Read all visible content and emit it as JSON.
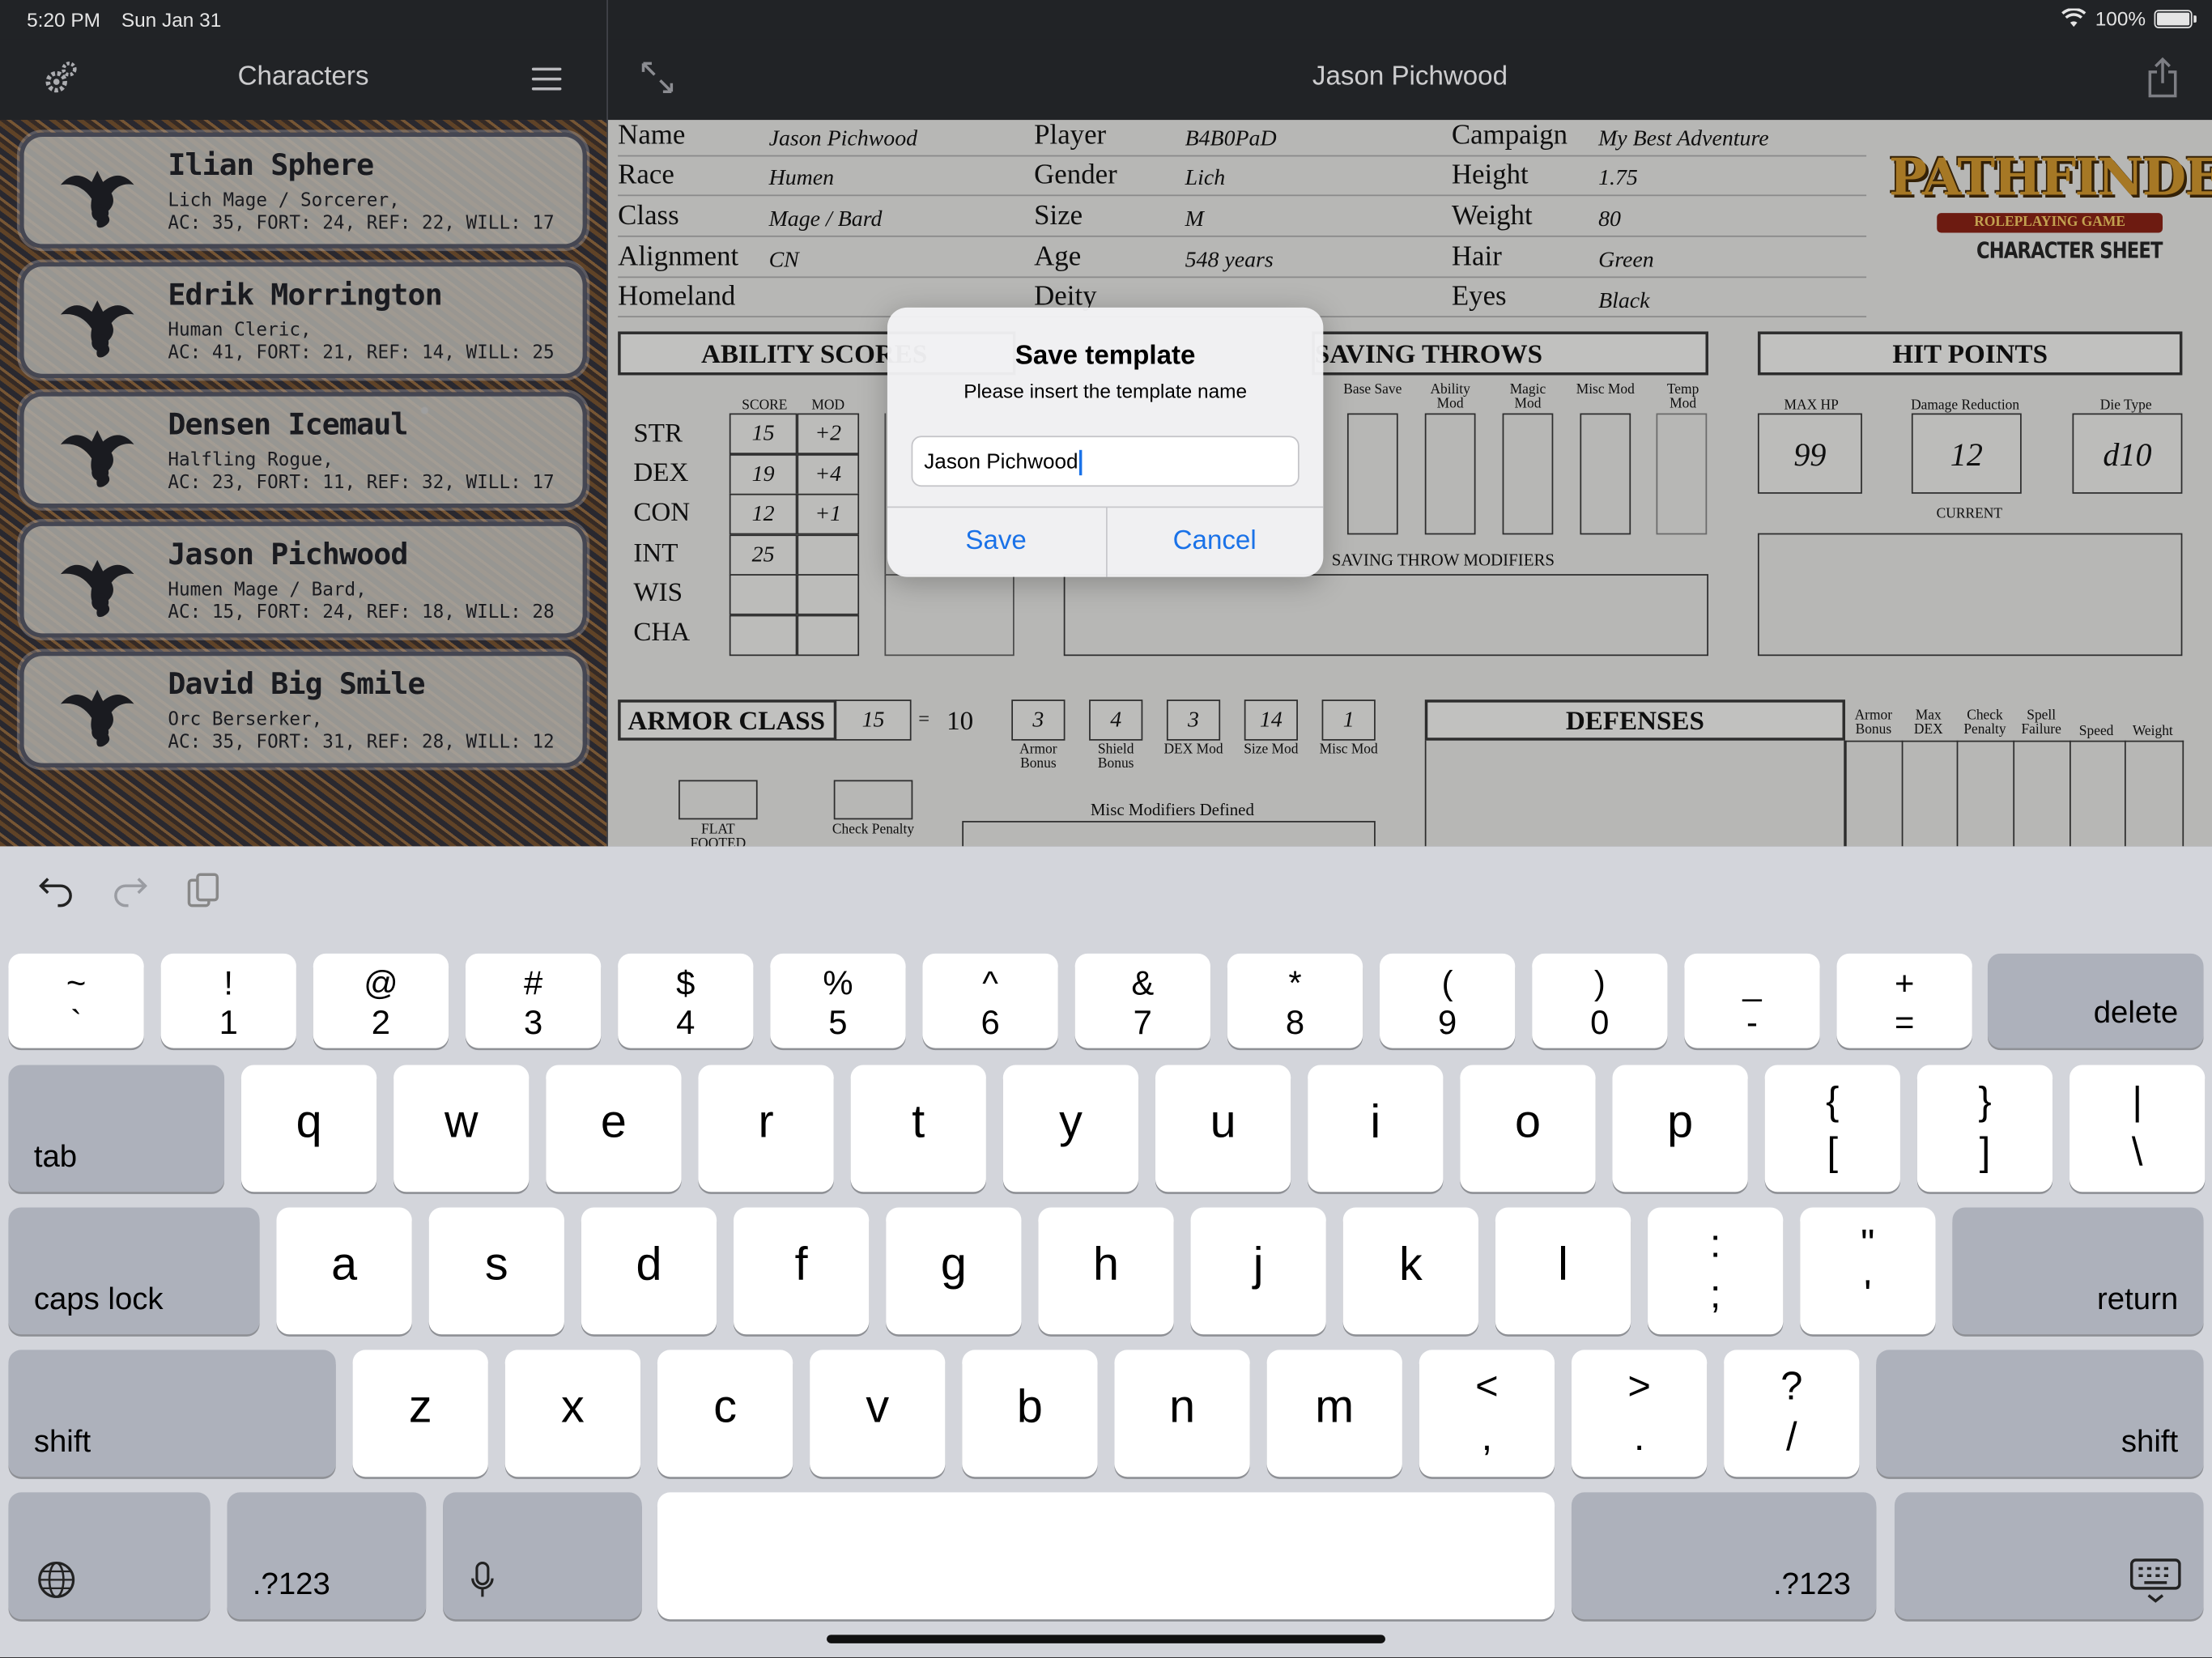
{
  "status": {
    "time": "5:20 PM",
    "date": "Sun Jan 31",
    "battery": "100%"
  },
  "sidebar": {
    "title": "Characters",
    "characters": [
      {
        "name": "Ilian Sphere",
        "line1": "Lich  Mage / Sorcerer,",
        "line2": "AC: 35, FORT: 24, REF: 22, WILL: 17"
      },
      {
        "name": "Edrik Morrington",
        "line1": "Human  Cleric,",
        "line2": "AC: 41, FORT: 21, REF: 14, WILL: 25"
      },
      {
        "name": "Densen Icemaul",
        "line1": "Halfling  Rogue,",
        "line2": "AC: 23, FORT: 11, REF: 32, WILL: 17"
      },
      {
        "name": "Jason Pichwood",
        "line1": "Humen  Mage / Bard,",
        "line2": "AC: 15, FORT: 24, REF: 18, WILL: 28"
      },
      {
        "name": "David Big Smile",
        "line1": "Orc  Berserker,",
        "line2": "AC: 35, FORT: 31, REF: 28, WILL: 12"
      }
    ]
  },
  "detail": {
    "title": "Jason Pichwood"
  },
  "sheet": {
    "labels": {
      "name": "Name",
      "player": "Player",
      "campaign": "Campaign",
      "race": "Race",
      "gender": "Gender",
      "height": "Height",
      "class": "Class",
      "size": "Size",
      "weight": "Weight",
      "alignment": "Alignment",
      "age": "Age",
      "hair": "Hair",
      "homeland": "Homeland",
      "deity": "Deity",
      "eyes": "Eyes"
    },
    "values": {
      "name": "Jason Pichwood",
      "player": "B4B0PaD",
      "campaign": "My Best Adventure",
      "race": "Humen",
      "gender": "Lich",
      "height": "1.75",
      "class": "Mage / Bard",
      "size": "M",
      "weight": "80",
      "alignment": "CN",
      "age": "548 years",
      "hair": "Green",
      "eyes": "Black"
    },
    "logo": {
      "title": "PATHFINDER",
      "sub": "ROLEPLAYING GAME",
      "caption": "CHARACTER SHEET"
    },
    "ability": {
      "header": "ABILITY SCORES",
      "score_hdr": "SCORE",
      "mod_hdr": "MOD",
      "rows": [
        {
          "label": "STR",
          "score": "15",
          "mod": "+2"
        },
        {
          "label": "DEX",
          "score": "19",
          "mod": "+4"
        },
        {
          "label": "CON",
          "score": "12",
          "mod": "+1"
        },
        {
          "label": "INT",
          "score": "25",
          "mod": ""
        },
        {
          "label": "WIS",
          "score": "",
          "mod": ""
        },
        {
          "label": "CHA",
          "score": "",
          "mod": ""
        }
      ]
    },
    "saves": {
      "header": "SAVING THROWS",
      "cols": [
        "Base Save",
        "Ability Mod",
        "Magic Mod",
        "Misc Mod",
        "Temp Mod"
      ],
      "modifiers": "SAVING THROW MODIFIERS"
    },
    "hp": {
      "header": "HIT POINTS",
      "max_lbl": "MAX HP",
      "dr_lbl": "Damage Reduction",
      "die_lbl": "Die Type",
      "max": "99",
      "dr": "12",
      "die": "d10",
      "current": "CURRENT"
    },
    "ac": {
      "header": "ARMOR CLASS",
      "total": "15",
      "base": "10",
      "armor": "3",
      "shield": "4",
      "dex": "3",
      "size": "14",
      "misc": "1",
      "armor_lbl": "Armor Bonus",
      "shield_lbl": "Shield Bonus",
      "dex_lbl": "DEX Mod",
      "size_lbl": "Size Mod",
      "misc_lbl": "Misc Mod",
      "flat": "FLAT FOOTED",
      "check": "Check Penalty",
      "misc_defined": "Misc  Modifiers  Defined"
    },
    "defenses": {
      "header": "DEFENSES",
      "cols": [
        "Armor Bonus",
        "Max DEX",
        "Check Penalty",
        "Spell Failure",
        "Speed",
        "Weight"
      ]
    }
  },
  "dialog": {
    "title": "Save template",
    "message": "Please insert the template name",
    "input_value": "Jason Pichwood",
    "save": "Save",
    "cancel": "Cancel"
  },
  "keyboard": {
    "row1": [
      [
        "~",
        "`"
      ],
      [
        "!",
        "1"
      ],
      [
        "@",
        "2"
      ],
      [
        "#",
        "3"
      ],
      [
        "$",
        "4"
      ],
      [
        "%",
        "5"
      ],
      [
        "^",
        "6"
      ],
      [
        "&",
        "7"
      ],
      [
        "*",
        "8"
      ],
      [
        "(",
        "9"
      ],
      [
        ")",
        "0"
      ],
      [
        "_",
        "-"
      ],
      [
        "+",
        "="
      ]
    ],
    "delete": "delete",
    "tab": "tab",
    "row2": [
      "q",
      "w",
      "e",
      "r",
      "t",
      "y",
      "u",
      "i",
      "o",
      "p"
    ],
    "row2_sym": [
      [
        "{",
        "["
      ],
      [
        "}",
        "]"
      ],
      [
        "|",
        "\\"
      ]
    ],
    "caps": "caps lock",
    "row3": [
      "a",
      "s",
      "d",
      "f",
      "g",
      "h",
      "j",
      "k",
      "l"
    ],
    "row3_sym": [
      [
        ":",
        ";"
      ],
      [
        "\"",
        "'"
      ]
    ],
    "return": "return",
    "shift": "shift",
    "row4": [
      "z",
      "x",
      "c",
      "v",
      "b",
      "n",
      "m"
    ],
    "row4_sym": [
      [
        "<",
        ","
      ],
      [
        ">",
        "."
      ],
      [
        "?",
        "/"
      ]
    ],
    "numbers": ".?123"
  }
}
